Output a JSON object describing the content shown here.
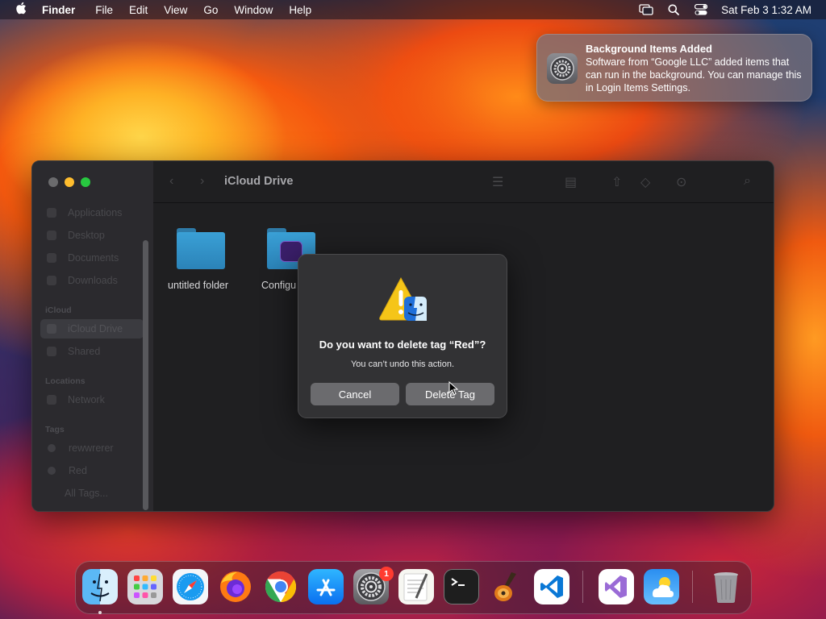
{
  "menubar": {
    "app_name": "Finder",
    "items": [
      "File",
      "Edit",
      "View",
      "Go",
      "Window",
      "Help"
    ],
    "clock": "Sat Feb 3  1:32 AM",
    "status_icons": [
      "screen-mirroring-icon",
      "spotlight-search-icon",
      "control-center-icon"
    ]
  },
  "notification": {
    "title": "Background Items Added",
    "body": "Software from “Google LLC” added items that can run in the background. You can manage this in Login Items Settings.",
    "icon": "system-settings-icon"
  },
  "finder": {
    "title": "iCloud Drive",
    "favorites": [
      "Applications",
      "Desktop",
      "Documents",
      "Downloads"
    ],
    "icloud_heading": "iCloud",
    "icloud_items": [
      "iCloud Drive",
      "Shared"
    ],
    "locations_heading": "Locations",
    "locations_items": [
      "Network"
    ],
    "tags_heading": "Tags",
    "tags_items": [
      "rewwrerer",
      "Red",
      "All Tags..."
    ],
    "files": [
      "untitled folder",
      "Configu"
    ],
    "selected_sidebar_item": "iCloud Drive"
  },
  "dialog": {
    "heading": "Do you want to delete tag “Red”?",
    "message": "You can’t undo this action.",
    "cancel_label": "Cancel",
    "confirm_label": "Delete Tag"
  },
  "dock": {
    "apps": [
      "Finder",
      "Launchpad",
      "Safari",
      "Firefox",
      "Google Chrome",
      "App Store",
      "System Settings",
      "TextEdit",
      "Terminal",
      "GarageBand",
      "Visual Studio Code",
      "Visual Studio",
      "Weather",
      "Trash"
    ],
    "settings_badge": "1"
  },
  "colors": {
    "dialog_bg": "#323234",
    "button_bg": "#6b6b6e",
    "badge_red": "#ff3b30",
    "folder_blue": "#3aa0d6"
  }
}
